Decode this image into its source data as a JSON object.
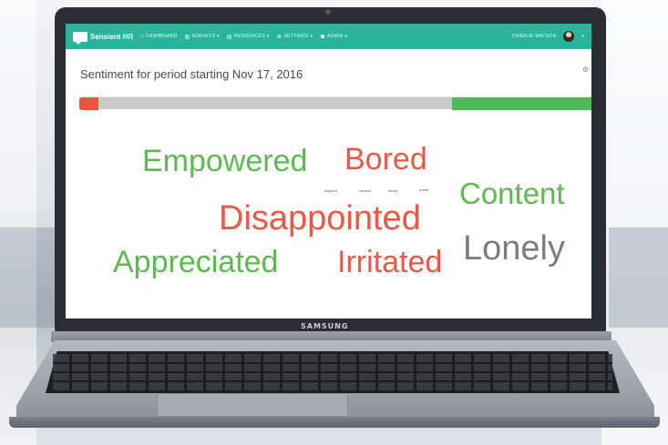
{
  "app": {
    "brand": "Sensient HR",
    "nav": [
      {
        "icon": "home-icon",
        "label": "DASHBOARD"
      },
      {
        "icon": "chart-icon",
        "label": "SURVEYS ▾"
      },
      {
        "icon": "document-icon",
        "label": "RESOURCES ▾"
      },
      {
        "icon": "gear-icon",
        "label": "SETTINGS ▾"
      },
      {
        "icon": "user-icon",
        "label": "ADMIN ▾"
      }
    ],
    "user_name": "CHARLIE WATSON",
    "user_caret": "▾"
  },
  "laptop_brand": "SAMSUNG",
  "page": {
    "title": "Sentiment for period starting Nov 17, 2016",
    "corner_icon": "gear-icon"
  },
  "sentiment_bar": {
    "negative_fraction": 0.037,
    "neutral_fraction": 0.69,
    "positive_fraction": 0.273,
    "colors": {
      "negative": "#e8553b",
      "neutral": "#c9c9c9",
      "positive": "#4cba57"
    }
  },
  "word_cloud": {
    "colors": {
      "positive": "#5cba4f",
      "negative": "#e85a45",
      "neutral": "#7d7d7d",
      "small": "#555555"
    },
    "words": [
      {
        "text": "Empowered",
        "sentiment": "positive"
      },
      {
        "text": "Bored",
        "sentiment": "negative"
      },
      {
        "text": "Content",
        "sentiment": "positive"
      },
      {
        "text": "Disappointed",
        "sentiment": "negative"
      },
      {
        "text": "Lonely",
        "sentiment": "neutral"
      },
      {
        "text": "Appreciated",
        "sentiment": "positive"
      },
      {
        "text": "Irritated",
        "sentiment": "negative"
      },
      {
        "text": "inspired",
        "sentiment": "small"
      },
      {
        "text": "content",
        "sentiment": "small"
      },
      {
        "text": "lonely",
        "sentiment": "small"
      },
      {
        "text": "bored",
        "sentiment": "small"
      }
    ]
  }
}
